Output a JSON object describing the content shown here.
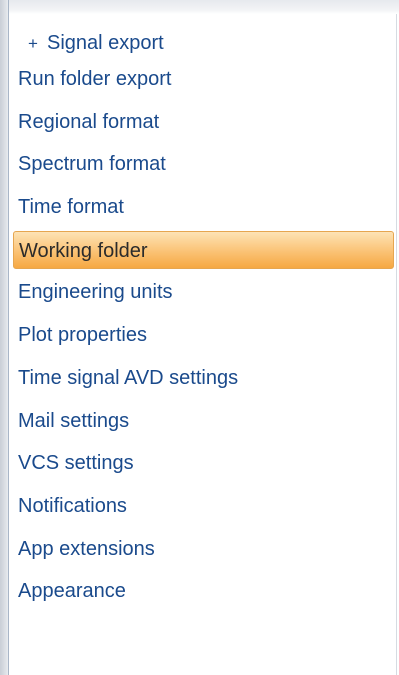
{
  "nav": {
    "first_item": {
      "icon": "plus-icon",
      "icon_glyph": "+",
      "label": "Signal export"
    },
    "items": [
      {
        "label": "Run folder export"
      },
      {
        "label": "Regional format"
      },
      {
        "label": "Spectrum format"
      },
      {
        "label": "Time format"
      },
      {
        "label": "Working folder",
        "selected": true
      },
      {
        "label": "Engineering units"
      },
      {
        "label": "Plot properties"
      },
      {
        "label": "Time signal AVD settings"
      },
      {
        "label": "Mail settings"
      },
      {
        "label": "VCS settings"
      },
      {
        "label": "Notifications"
      },
      {
        "label": "App extensions"
      },
      {
        "label": "Appearance"
      }
    ]
  },
  "colors": {
    "link_text": "#1a4a8c",
    "selected_text": "#2b2b2b",
    "selected_highlight": "#fbc57a",
    "selected_border": "#e6a650"
  }
}
